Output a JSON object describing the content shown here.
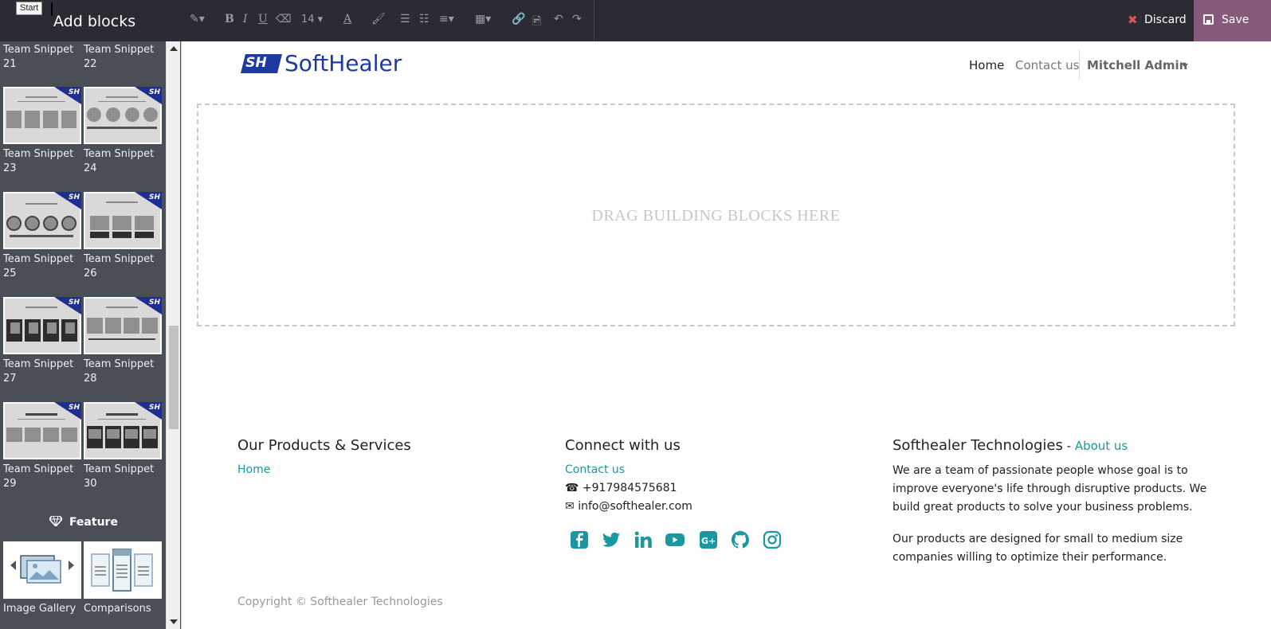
{
  "sidebar": {
    "title": "Add blocks",
    "tooltip": "Start",
    "snippets": [
      {
        "label": "Team Snippet 21",
        "line1": "Team Snippet",
        "line2": "21"
      },
      {
        "label": "Team Snippet 22",
        "line1": "Team Snippet",
        "line2": "22"
      },
      {
        "label": "Team Snippet 23",
        "line1": "Team Snippet",
        "line2": "23"
      },
      {
        "label": "Team Snippet 24",
        "line1": "Team Snippet",
        "line2": "24"
      },
      {
        "label": "Team Snippet 25",
        "line1": "Team Snippet",
        "line2": "25"
      },
      {
        "label": "Team Snippet 26",
        "line1": "Team Snippet",
        "line2": "26"
      },
      {
        "label": "Team Snippet 27",
        "line1": "Team Snippet",
        "line2": "27"
      },
      {
        "label": "Team Snippet 28",
        "line1": "Team Snippet",
        "line2": "28"
      },
      {
        "label": "Team Snippet 29",
        "line1": "Team Snippet",
        "line2": "29"
      },
      {
        "label": "Team Snippet 30",
        "line1": "Team Snippet",
        "line2": "30"
      }
    ],
    "thumb_badge": "SH",
    "feature_section": "Feature",
    "feature_items": [
      {
        "label": "Image Gallery"
      },
      {
        "label": "Comparisons"
      }
    ]
  },
  "toolbar": {
    "font_size": "14",
    "discard_label": "Discard",
    "save_label": "Save",
    "icons": [
      "magic-wand-icon",
      "bold-icon",
      "italic-icon",
      "underline-icon",
      "eraser-icon",
      "font-size-dropdown",
      "font-color-icon",
      "paint-brush-icon",
      "bullet-list-icon",
      "numbered-list-icon",
      "align-icon",
      "table-icon",
      "link-icon",
      "image-icon",
      "undo-icon",
      "redo-icon"
    ]
  },
  "header": {
    "logo_mark": "SH",
    "logo_text": "SoftHealer",
    "nav": {
      "home": "Home",
      "contact": "Contact us",
      "user": "Mitchell Admin"
    }
  },
  "dropzone": {
    "text": "DRAG BUILDING BLOCKS HERE"
  },
  "footer": {
    "col1": {
      "title": "Our Products & Services",
      "link": "Home"
    },
    "col2": {
      "title": "Connect with us",
      "link": "Contact us",
      "phone": "+917984575681",
      "email": "info@softhealer.com",
      "socials": [
        "facebook-icon",
        "twitter-icon",
        "linkedin-icon",
        "youtube-icon",
        "google-plus-icon",
        "github-icon",
        "instagram-icon"
      ]
    },
    "col3": {
      "title": "Softhealer Technologies",
      "title_sep": " - ",
      "about_link": "About us",
      "para1_l1": "We are a team of passionate people whose goal is to",
      "para1_l2": "improve everyone's life through disruptive products. We",
      "para1_l3": "build great products to solve your business problems.",
      "para2_l1": "Our products are designed for small to medium size",
      "para2_l2": "companies willing to optimize their performance."
    },
    "copyright": "Copyright © Softhealer Technologies"
  },
  "colors": {
    "accent": "#1a98a0",
    "save": "#875a7b",
    "toolbar": "#2c2b33",
    "sidebar": "#4a4e57",
    "brand": "#1d3aa3"
  }
}
